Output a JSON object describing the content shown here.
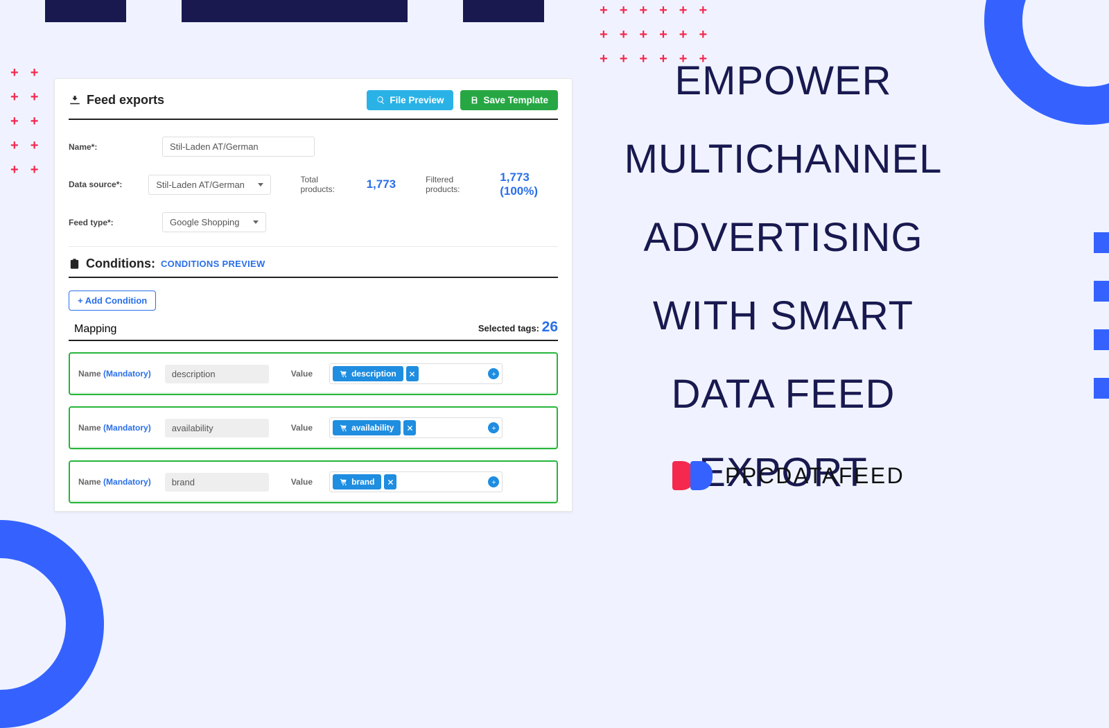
{
  "headline": "Empower multichannel advertising with smart data feed export",
  "brand": "PPCDATAFEED",
  "panel": {
    "title": "Feed exports",
    "buttons": {
      "preview": "File Preview",
      "save": "Save Template"
    },
    "fields": {
      "name_label": "Name*:",
      "name_value": "Stil-Laden AT/German",
      "data_source_label": "Data source*:",
      "data_source_value": "Stil-Laden AT/German",
      "total_products_label": "Total products:",
      "total_products_value": "1,773",
      "filtered_products_label": "Filtered products:",
      "filtered_products_value": "1,773 (100%)",
      "feed_type_label": "Feed type*:",
      "feed_type_value": "Google Shopping"
    },
    "conditions": {
      "title": "Conditions:",
      "preview_link": "CONDITIONS PREVIEW",
      "add_btn": "+ Add Condition"
    },
    "mapping": {
      "title": "Mapping",
      "selected_label": "Selected tags:",
      "selected_count": "26",
      "name_label": "Name",
      "mandatory": "(Mandatory)",
      "value_label": "Value",
      "rows": [
        {
          "name": "description",
          "tag": "description"
        },
        {
          "name": "availability",
          "tag": "availability"
        },
        {
          "name": "brand",
          "tag": "brand"
        }
      ]
    }
  }
}
